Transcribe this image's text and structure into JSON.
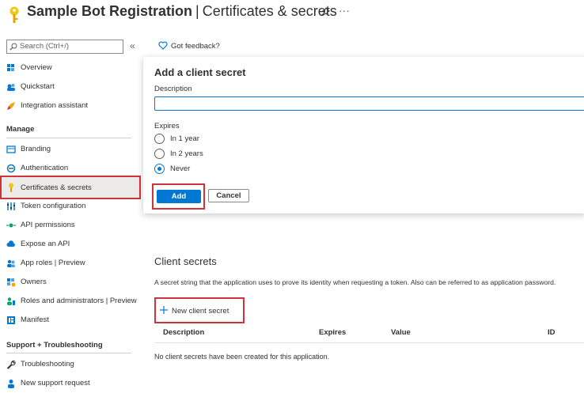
{
  "header": {
    "app_name": "Sample Bot Registration",
    "separator": "|",
    "page_name": "Certificates & secrets",
    "more": "···"
  },
  "sidebar": {
    "search_placeholder": "Search (Ctrl+/)",
    "collapse": "«",
    "items_top": [
      {
        "label": "Overview",
        "icon": "grid-icon"
      },
      {
        "label": "Quickstart",
        "icon": "cloud-people-icon"
      },
      {
        "label": "Integration assistant",
        "icon": "rocket-icon"
      }
    ],
    "manage_heading": "Manage",
    "items_manage": [
      {
        "label": "Branding",
        "icon": "branding-icon"
      },
      {
        "label": "Authentication",
        "icon": "authentication-icon"
      },
      {
        "label": "Certificates & secrets",
        "icon": "key-icon",
        "active": true
      },
      {
        "label": "Token configuration",
        "icon": "token-icon"
      },
      {
        "label": "API permissions",
        "icon": "api-permissions-icon"
      },
      {
        "label": "Expose an API",
        "icon": "cloud-icon"
      },
      {
        "label": "App roles | Preview",
        "icon": "app-roles-icon"
      },
      {
        "label": "Owners",
        "icon": "owners-icon"
      },
      {
        "label": "Roles and administrators | Preview",
        "icon": "roles-admin-icon"
      },
      {
        "label": "Manifest",
        "icon": "manifest-icon"
      }
    ],
    "support_heading": "Support + Troubleshooting",
    "items_support": [
      {
        "label": "Troubleshooting",
        "icon": "wrench-icon"
      },
      {
        "label": "New support request",
        "icon": "support-person-icon"
      }
    ]
  },
  "feedback": {
    "label": "Got feedback?"
  },
  "panel": {
    "title": "Add a client secret",
    "description_label": "Description",
    "description_value": "",
    "expires_label": "Expires",
    "options": [
      {
        "label": "In 1 year",
        "checked": false
      },
      {
        "label": "In 2 years",
        "checked": false
      },
      {
        "label": "Never",
        "checked": true
      }
    ],
    "add_label": "Add",
    "cancel_label": "Cancel"
  },
  "client_secrets": {
    "title": "Client secrets",
    "description": "A secret string that the application uses to prove its identity when requesting a token. Also can be referred to as application password.",
    "new_secret_label": "New client secret",
    "columns": [
      "Description",
      "Expires",
      "Value",
      "ID"
    ],
    "empty_message": "No client secrets have been created for this application."
  },
  "colors": {
    "accent": "#0078d4",
    "highlight_border": "#d13438",
    "key_yellow": "#f2c811"
  }
}
